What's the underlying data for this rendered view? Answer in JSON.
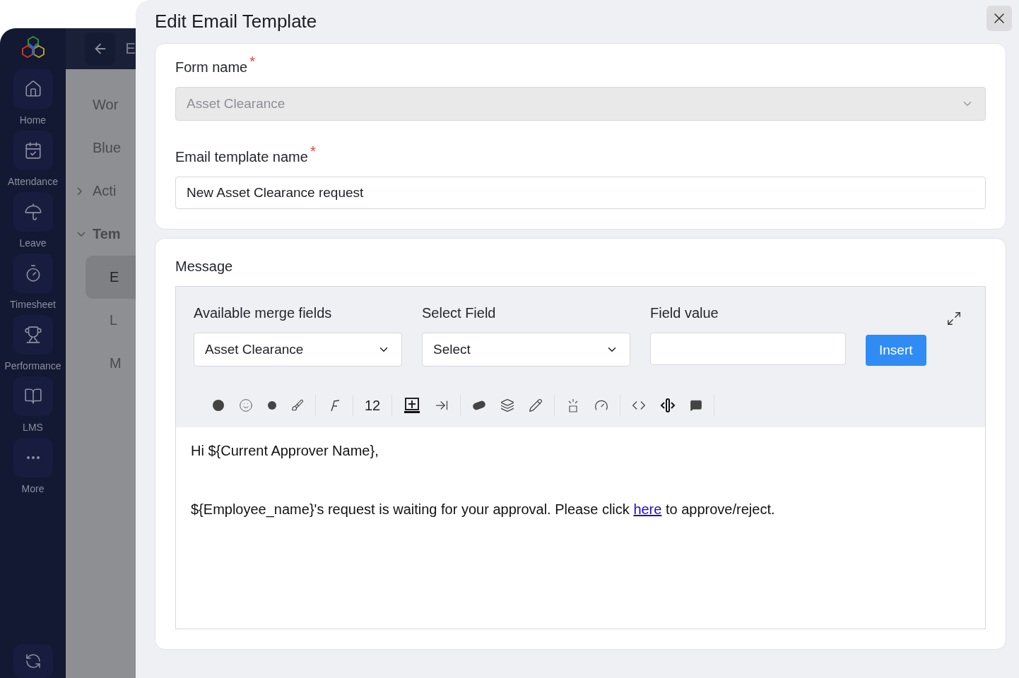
{
  "sidebar": {
    "items": [
      {
        "label": "Home"
      },
      {
        "label": "Attendance"
      },
      {
        "label": "Leave"
      },
      {
        "label": "Timesheet"
      },
      {
        "label": "Performance"
      },
      {
        "label": "LMS"
      },
      {
        "label": "More"
      }
    ]
  },
  "background_page": {
    "header_title": "E",
    "items": [
      {
        "label": "Wor",
        "kind": "plain"
      },
      {
        "label": "Blue",
        "kind": "plain"
      },
      {
        "label": "Acti",
        "kind": "group",
        "expanded": false
      },
      {
        "label": "Tem",
        "kind": "group",
        "expanded": true
      },
      {
        "label": "E",
        "kind": "sub",
        "selected": true
      },
      {
        "label": "L",
        "kind": "sub",
        "selected": false
      },
      {
        "label": "M",
        "kind": "sub",
        "selected": false
      }
    ]
  },
  "dialog": {
    "title": "Edit Email Template",
    "required_mark": "*",
    "form_name": {
      "label": "Form name",
      "required": true,
      "value": "Asset Clearance",
      "disabled": true
    },
    "template_name": {
      "label": "Email template name",
      "required": true,
      "value": "New Asset Clearance request"
    },
    "message": {
      "label": "Message",
      "merge_fields": {
        "label": "Available merge fields",
        "value": "Asset Clearance"
      },
      "select_field": {
        "label": "Select Field",
        "value": "Select"
      },
      "field_value": {
        "label": "Field value"
      },
      "insert_button": "Insert",
      "font_size": "12",
      "body": [
        {
          "text": "Hi ${Current Approver Name},"
        },
        {
          "before": "${Employee_name}'s request is waiting for your approval. Please click ",
          "link": "here",
          "after": " to approve/reject."
        }
      ]
    }
  }
}
